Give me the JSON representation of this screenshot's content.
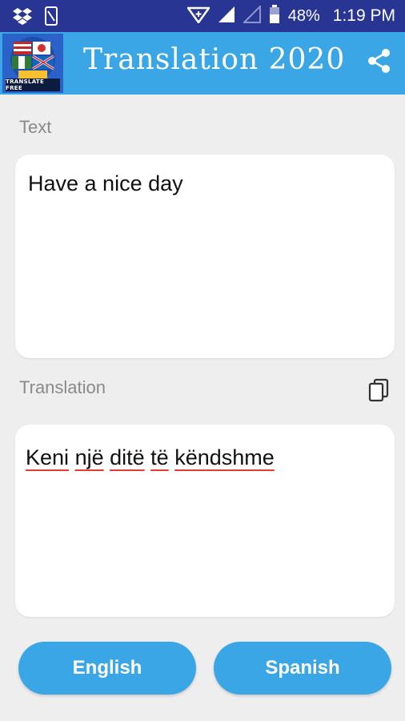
{
  "status_bar": {
    "battery_percent": "48%",
    "time": "1:19 PM",
    "icons": [
      "dropbox-icon",
      "phone-notification-icon",
      "data-saver-icon",
      "signal-full-icon",
      "signal-empty-icon",
      "battery-icon"
    ]
  },
  "app_bar": {
    "logo_text": "TRANSLATE FREE",
    "title": "Translation 2020",
    "share_icon": "share-icon"
  },
  "input": {
    "label": "Text",
    "value": "Have a nice day"
  },
  "output": {
    "label": "Translation",
    "words": [
      "Keni",
      "një",
      "ditë",
      "të",
      "këndshme"
    ],
    "copy_icon": "copy-icon"
  },
  "languages": {
    "source": "English",
    "target": "Spanish"
  },
  "colors": {
    "status_bar": "#283593",
    "accent": "#3aa6e6",
    "background": "#eeeeee",
    "spell_error": "#e53935"
  }
}
